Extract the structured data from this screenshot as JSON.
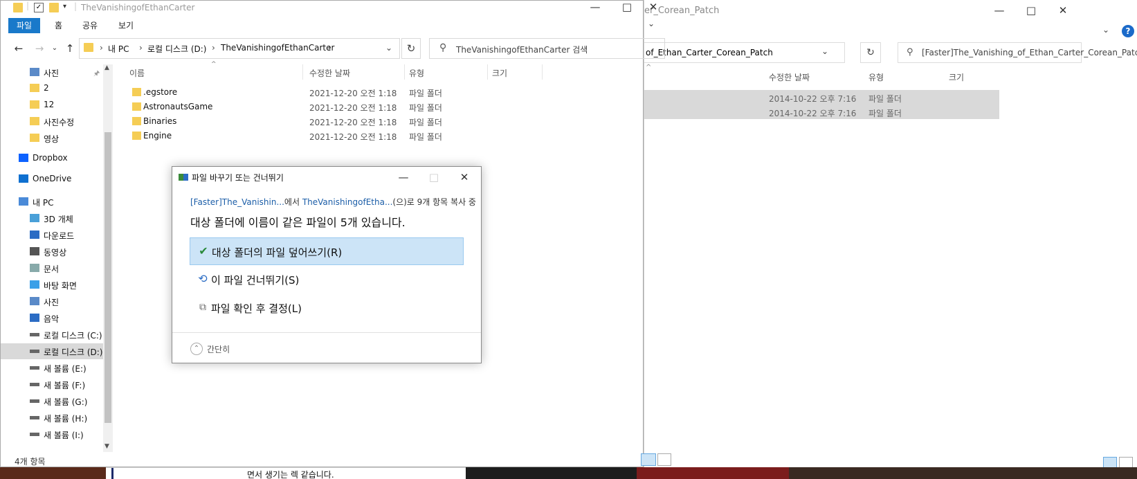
{
  "main_window": {
    "title": "TheVanishingofEthanCarter",
    "ribbon_tabs": [
      "파일",
      "홈",
      "공유",
      "보기"
    ],
    "breadcrumb": [
      "내 PC",
      "로컬 디스크 (D:)",
      "TheVanishingofEthanCarter"
    ],
    "search_placeholder": "TheVanishingofEthanCarter 검색",
    "sidebar": {
      "items": [
        {
          "label": "사진",
          "icon": "pictures-icon"
        },
        {
          "label": "2",
          "icon": "folder-icon"
        },
        {
          "label": "12",
          "icon": "folder-icon"
        },
        {
          "label": "사진수정",
          "icon": "folder-icon"
        },
        {
          "label": "영상",
          "icon": "folder-icon"
        },
        {
          "label": "Dropbox",
          "icon": "dropbox-icon"
        },
        {
          "label": "OneDrive",
          "icon": "onedrive-icon"
        },
        {
          "label": "내 PC",
          "icon": "pc-icon"
        },
        {
          "label": "3D 개체",
          "icon": "3d-objects-icon"
        },
        {
          "label": "다운로드",
          "icon": "download-icon"
        },
        {
          "label": "동영상",
          "icon": "video-icon"
        },
        {
          "label": "문서",
          "icon": "document-icon"
        },
        {
          "label": "바탕 화면",
          "icon": "desktop-icon"
        },
        {
          "label": "사진",
          "icon": "pictures-icon"
        },
        {
          "label": "음악",
          "icon": "music-icon"
        },
        {
          "label": "로컬 디스크 (C:)",
          "icon": "drive-icon"
        },
        {
          "label": "로컬 디스크 (D:)",
          "icon": "drive-icon"
        },
        {
          "label": "새 볼륨 (E:)",
          "icon": "drive-icon"
        },
        {
          "label": "새 볼륨 (F:)",
          "icon": "drive-icon"
        },
        {
          "label": "새 볼륨 (G:)",
          "icon": "drive-icon"
        },
        {
          "label": "새 볼륨 (H:)",
          "icon": "drive-icon"
        },
        {
          "label": "새 볼륨 (I:)",
          "icon": "drive-icon"
        }
      ]
    },
    "columns": [
      "이름",
      "수정한 날짜",
      "유형",
      "크기"
    ],
    "files": [
      {
        "name": ".egstore",
        "date": "2021-12-20 오전 1:18",
        "type": "파일 폴더"
      },
      {
        "name": "AstronautsGame",
        "date": "2021-12-20 오전 1:18",
        "type": "파일 폴더"
      },
      {
        "name": "Binaries",
        "date": "2021-12-20 오전 1:18",
        "type": "파일 폴더"
      },
      {
        "name": "Engine",
        "date": "2021-12-20 오전 1:18",
        "type": "파일 폴더"
      }
    ],
    "status": "4개 항목"
  },
  "bg_window": {
    "title": "er_Corean_Patch",
    "address": "of_Ethan_Carter_Corean_Patch",
    "search_placeholder": "[Faster]The_Vanishing_of_Ethan_Carter_Corean_Patch ...",
    "columns": [
      "수정한 날짜",
      "유형",
      "크기"
    ],
    "rows": [
      {
        "date": "2014-10-22 오후 7:16",
        "type": "파일 폴더"
      },
      {
        "date": "2014-10-22 오후 7:16",
        "type": "파일 폴더"
      }
    ]
  },
  "bottom_text": "면서 생기는 렉 같습니다.",
  "dialog": {
    "title": "파일 바꾸기 또는 건너뛰기",
    "src_link": "[Faster]The_Vanishin...",
    "mid1": "에서 ",
    "dst_link": "TheVanishingofEtha...",
    "mid2": "(으)로 9개 항목 복사 중",
    "headline": "대상 폴더에 이름이 같은 파일이 5개 있습니다.",
    "options": [
      {
        "label": "대상 폴더의 파일 덮어쓰기(R)",
        "icon": "checkmark-icon"
      },
      {
        "label": "이 파일 건너뛰기(S)",
        "icon": "skip-icon"
      },
      {
        "label": "파일 확인 후 결정(L)",
        "icon": "compare-icon"
      }
    ],
    "fewer_details": "간단히"
  },
  "colors": {
    "accent": "#1979ca",
    "selection": "#cce4f7",
    "folder": "#f5cd55"
  }
}
